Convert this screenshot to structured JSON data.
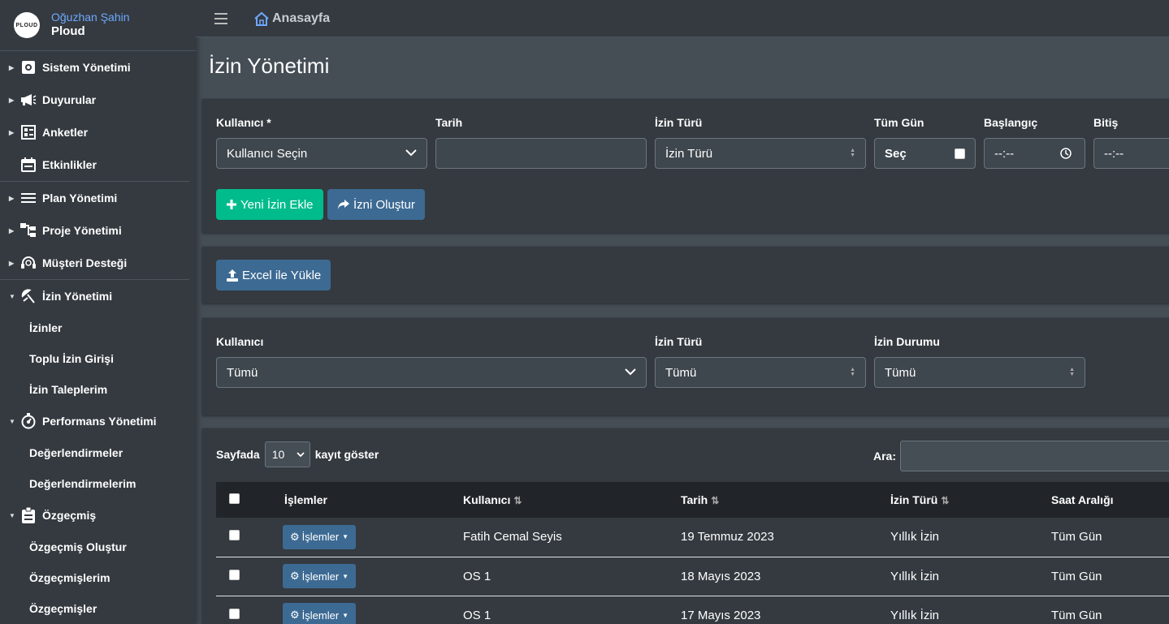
{
  "brand": {
    "logo_text": "PLOUD",
    "user_name": "Oğuzhan Şahin",
    "app_name": "Ploud"
  },
  "sidebar": {
    "items": [
      {
        "label": "Sistem Yönetimi",
        "icon": "gear-icon"
      },
      {
        "label": "Duyurular",
        "icon": "megaphone-icon"
      },
      {
        "label": "Anketler",
        "icon": "poll-icon"
      },
      {
        "label": "Etkinlikler",
        "icon": "calendar-icon"
      },
      {
        "label": "Plan Yönetimi",
        "icon": "list-icon"
      },
      {
        "label": "Proje Yönetimi",
        "icon": "sitemap-icon"
      },
      {
        "label": "Müşteri Desteği",
        "icon": "headset-icon"
      },
      {
        "label": "İzin Yönetimi",
        "icon": "umbrella-icon"
      },
      {
        "label": "Performans Yönetimi",
        "icon": "stopwatch-icon"
      },
      {
        "label": "Özgeçmiş",
        "icon": "clipboard-icon"
      }
    ],
    "izin_sub": [
      "İzinler",
      "Toplu İzin Girişi",
      "İzin Taleplerim"
    ],
    "performans_sub": [
      "Değerlendirmeler",
      "Değerlendirmelerim"
    ],
    "ozgecmis_sub": [
      "Özgeçmiş Oluştur",
      "Özgeçmişlerim",
      "Özgeçmişler"
    ]
  },
  "header": {
    "home_label": "Anasayfa"
  },
  "page": {
    "title": "İzin Yönetimi"
  },
  "form": {
    "user_label": "Kullanıcı *",
    "user_value": "Kullanıcı Seçin",
    "date_label": "Tarih",
    "date_value": "",
    "type_label": "İzin Türü",
    "type_value": "İzin Türü",
    "allday_label": "Tüm Gün",
    "allday_value": "Seç",
    "start_label": "Başlangıç",
    "start_value": "--:--",
    "end_label": "Bitiş",
    "end_value": "--:--",
    "add_button": "Yeni İzin Ekle",
    "create_button": "İzni Oluştur"
  },
  "excel": {
    "button": "Excel ile Yükle"
  },
  "filters": {
    "user_label": "Kullanıcı",
    "user_value": "Tümü",
    "type_label": "İzin Türü",
    "type_value": "Tümü",
    "status_label": "İzin Durumu",
    "status_value": "Tümü"
  },
  "table": {
    "show_prefix": "Sayfada",
    "page_size": "10",
    "show_suffix": "kayıt göster",
    "search_label": "Ara:",
    "search_value": "",
    "columns": [
      "İşlemler",
      "Kullanıcı",
      "Tarih",
      "İzin Türü",
      "Saat Aralığı"
    ],
    "action_label": "İşlemler",
    "rows": [
      {
        "user": "Fatih Cemal Seyis",
        "date": "19 Temmuz 2023",
        "type": "Yıllık İzin",
        "hours": "Tüm Gün"
      },
      {
        "user": "OS 1",
        "date": "18 Mayıs 2023",
        "type": "Yıllık İzin",
        "hours": "Tüm Gün"
      },
      {
        "user": "OS 1",
        "date": "17 Mayıs 2023",
        "type": "Yıllık İzin",
        "hours": "Tüm Gün"
      }
    ]
  },
  "colors": {
    "sidebar": "#343a40",
    "content": "#454d55",
    "green": "#00bc8c",
    "blue": "#3d6a93",
    "link": "#6ea8fe"
  }
}
